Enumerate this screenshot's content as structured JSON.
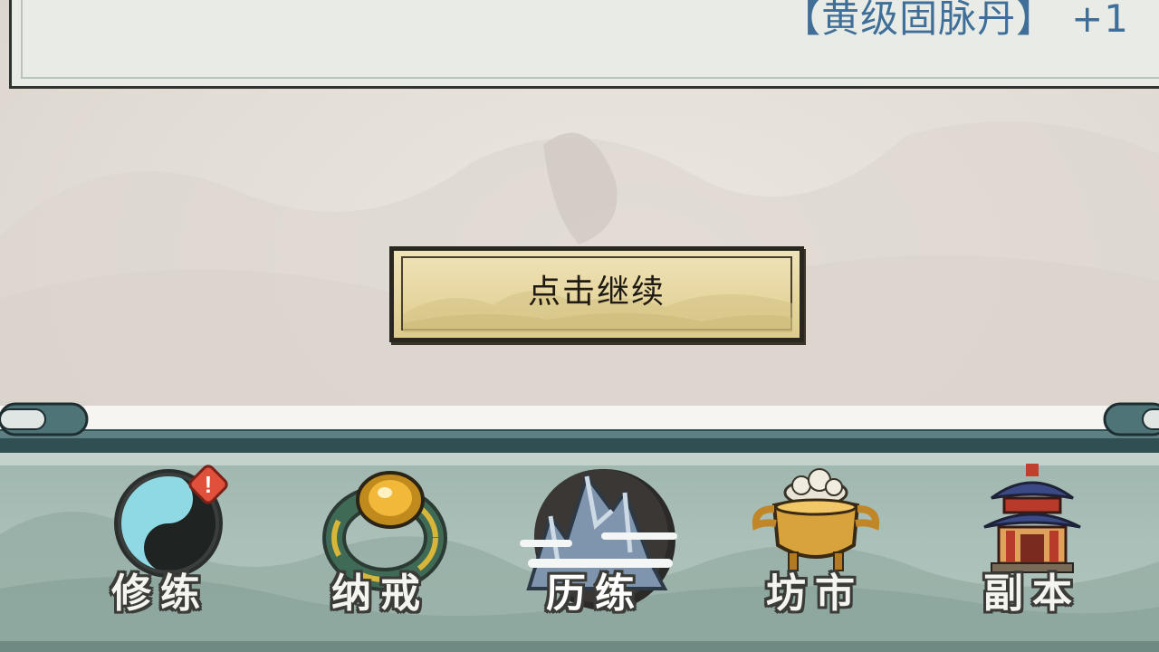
{
  "reward": {
    "item_name": "【黄级固脉丹】",
    "count": "+1"
  },
  "continue_button": {
    "label": "点击继续"
  },
  "bottom_nav": {
    "items": [
      {
        "label": "修练",
        "icon": "yin-yang-icon",
        "alert": true
      },
      {
        "label": "纳戒",
        "icon": "ring-icon",
        "alert": false
      },
      {
        "label": "历练",
        "icon": "mountain-icon",
        "alert": false,
        "selected": true
      },
      {
        "label": "坊市",
        "icon": "cauldron-icon",
        "alert": false
      },
      {
        "label": "副本",
        "icon": "pagoda-icon",
        "alert": false
      }
    ],
    "alert_mark": "!"
  },
  "colors": {
    "reward_text": "#3f6f98",
    "button_fill": "#e6d69f",
    "nav_bg": "#a9bfb7",
    "alert": "#e0503a"
  }
}
